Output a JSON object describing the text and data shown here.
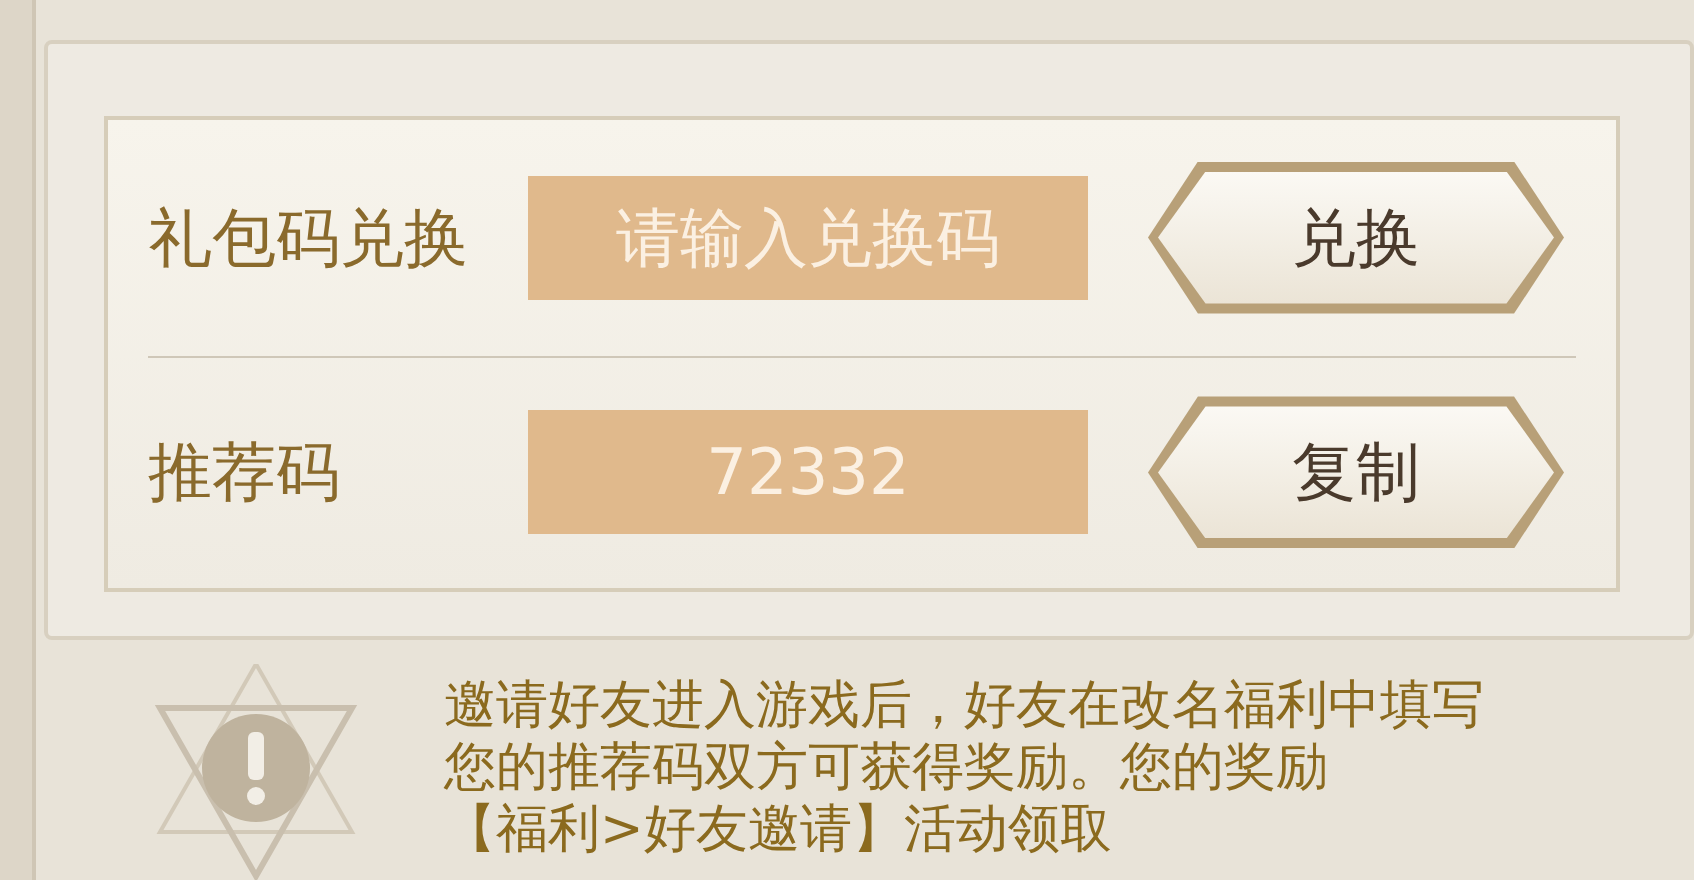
{
  "redeem_row": {
    "label": "礼包码兑换",
    "input": {
      "placeholder": "请输入兑换码"
    },
    "button": "兑换"
  },
  "referral_row": {
    "label": "推荐码",
    "field": {
      "value": "72332"
    },
    "button": "复制"
  },
  "notice": {
    "lines": [
      "邀请好友进入游戏后，好友在改名福利中填写",
      "您的推荐码双方可获得奖励。您的奖励",
      "【福利>好友邀请】活动领取"
    ]
  }
}
